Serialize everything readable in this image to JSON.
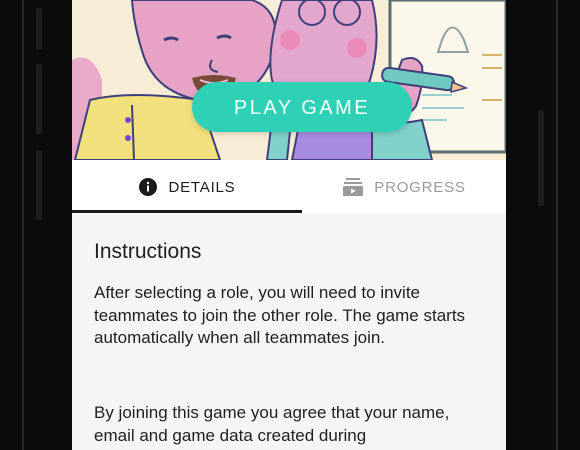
{
  "hero": {
    "play_button_label": "PLAY GAME",
    "accent_color": "#2ed1b6"
  },
  "tabs": [
    {
      "label": "DETAILS",
      "icon": "info-icon",
      "active": true
    },
    {
      "label": "PROGRESS",
      "icon": "progress-icon",
      "active": false
    }
  ],
  "instructions": {
    "title": "Instructions",
    "paragraph_1": "After selecting a role, you will need to invite teammates to join the other role. The game starts automatically when all teammates join.",
    "paragraph_2": "By joining this game you agree that your name, email and game data created during"
  }
}
